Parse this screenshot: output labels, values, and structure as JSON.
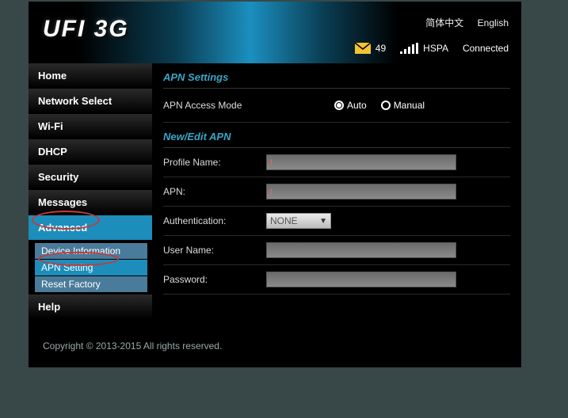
{
  "header": {
    "logo": "UFI 3G",
    "lang": {
      "zh": "简体中文",
      "en": "English"
    },
    "mail_count": "49",
    "network_type": "HSPA",
    "conn_status": "Connected"
  },
  "sidebar": {
    "items": [
      {
        "label": "Home"
      },
      {
        "label": "Network Select"
      },
      {
        "label": "Wi-Fi"
      },
      {
        "label": "DHCP"
      },
      {
        "label": "Security"
      },
      {
        "label": "Messages"
      },
      {
        "label": "Advanced"
      },
      {
        "label": "Help"
      }
    ],
    "advanced_sub": [
      {
        "label": "Device Information"
      },
      {
        "label": "APN Setting"
      },
      {
        "label": "Reset Factory"
      }
    ]
  },
  "main": {
    "title1": "APN Settings",
    "access_mode_label": "APN Access Mode",
    "access_mode": {
      "auto": "Auto",
      "manual": "Manual",
      "selected": "auto"
    },
    "title2": "New/Edit APN",
    "fields": {
      "profile_name": {
        "label": "Profile Name:",
        "value": "t"
      },
      "apn": {
        "label": "APN:",
        "value": "t"
      },
      "auth": {
        "label": "Authentication:",
        "value": "NONE"
      },
      "username": {
        "label": "User Name:",
        "value": ""
      },
      "password": {
        "label": "Password:",
        "value": ""
      }
    }
  },
  "footer": {
    "copyright": "Copyright © 2013-2015 All rights reserved."
  }
}
